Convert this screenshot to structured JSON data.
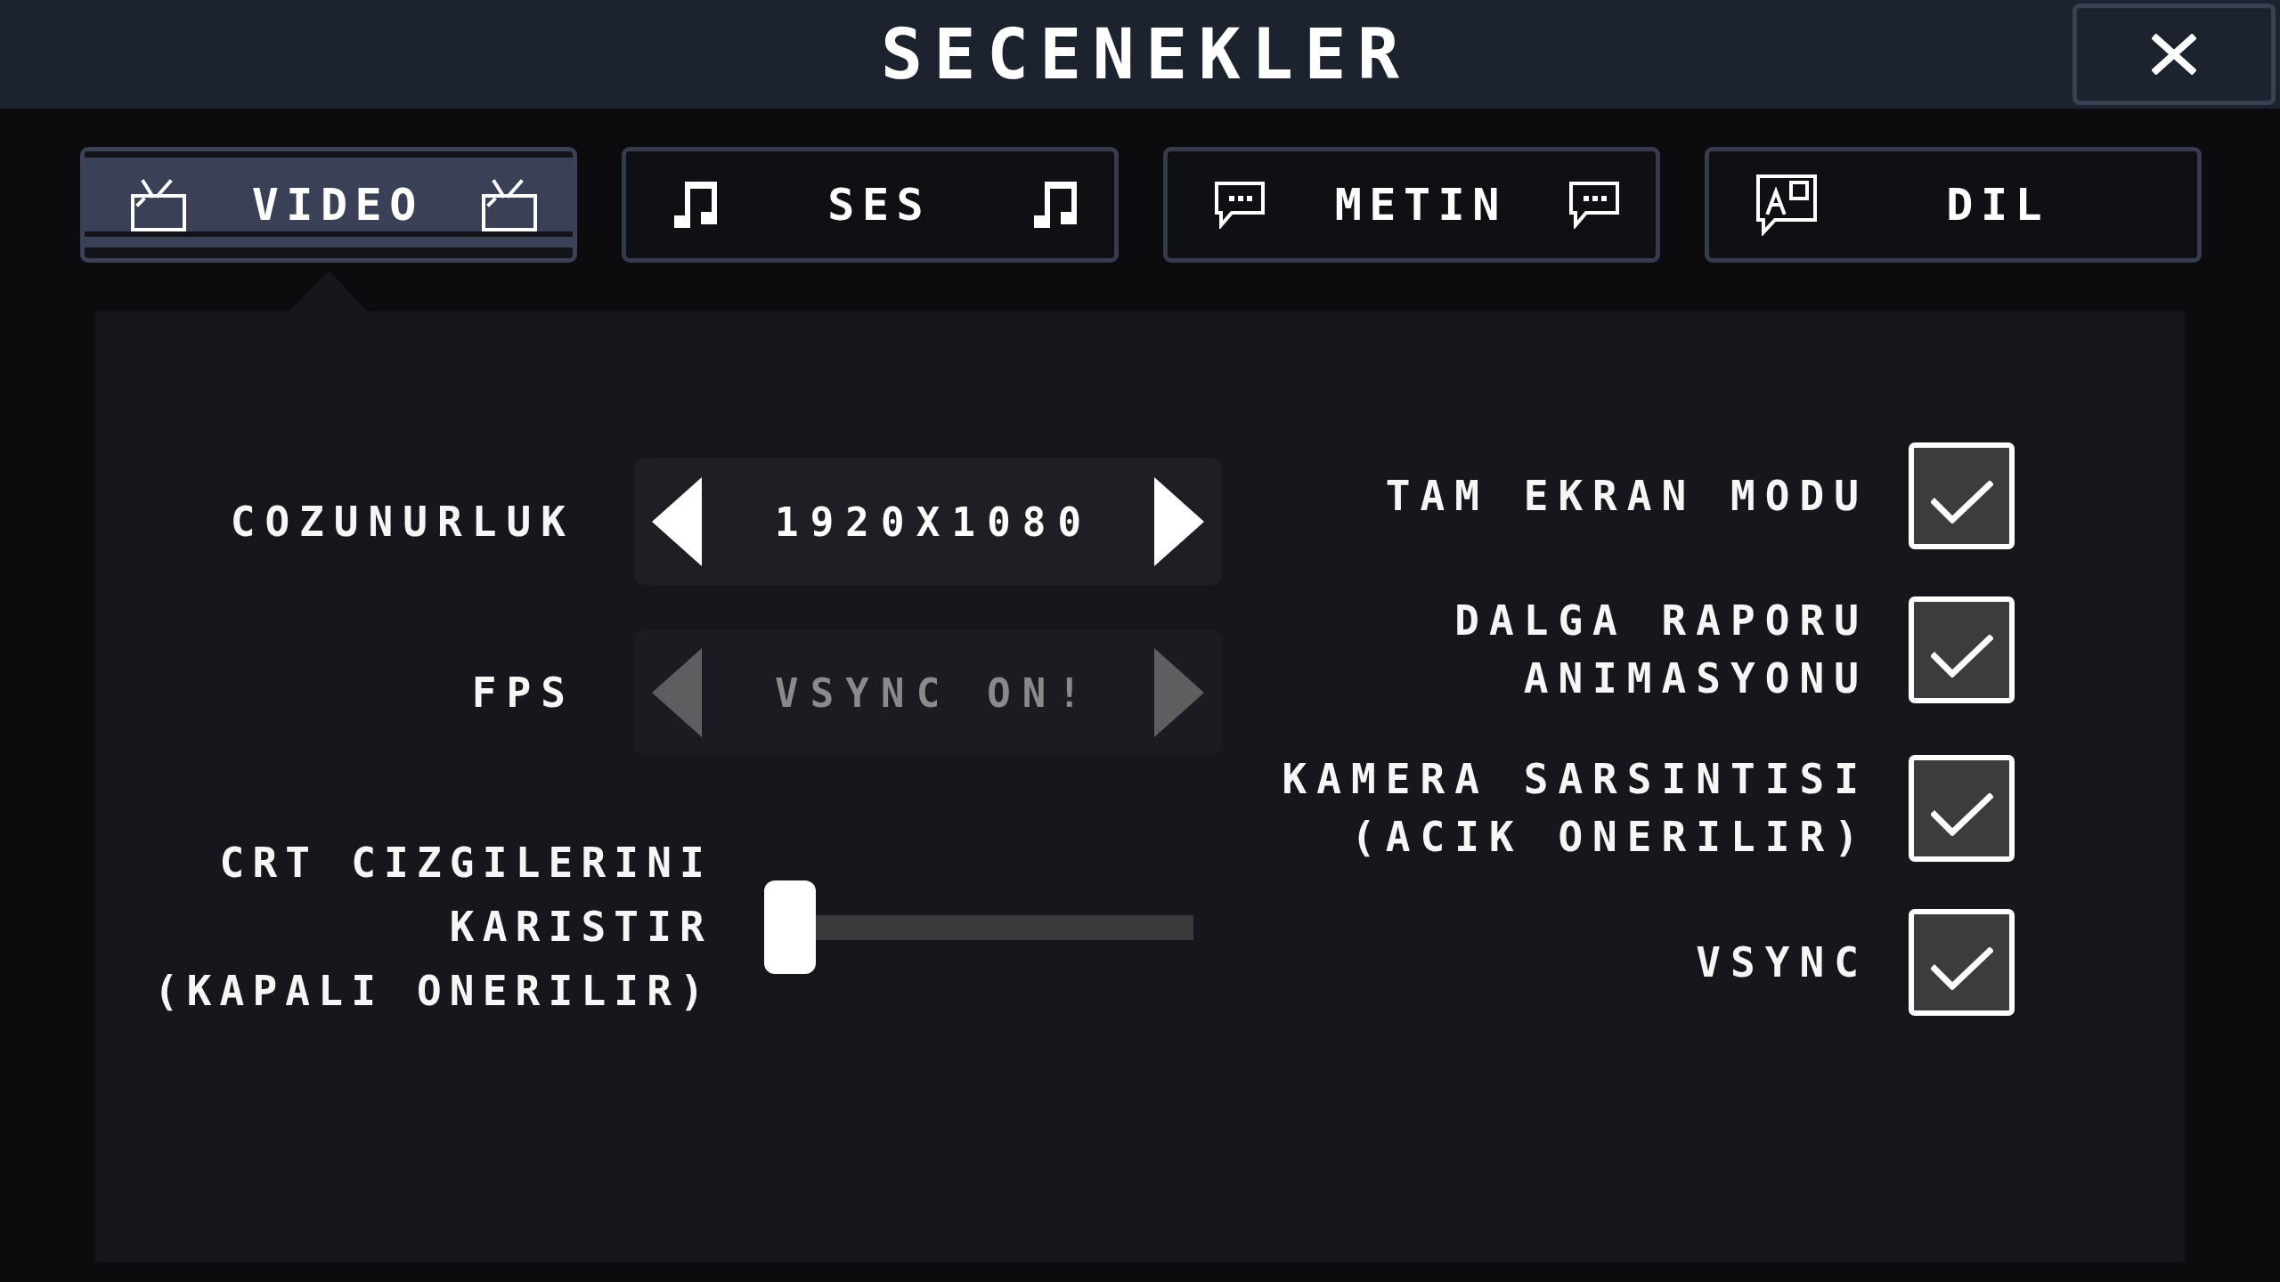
{
  "title": "SECENEKLER",
  "tabs": [
    {
      "label": "VIDEO",
      "kind": "video",
      "trailing_icon": true,
      "selected": true
    },
    {
      "label": "SES",
      "kind": "audio",
      "trailing_icon": true,
      "selected": false
    },
    {
      "label": "METIN",
      "kind": "text",
      "trailing_icon": true,
      "selected": false
    },
    {
      "label": "DIL",
      "kind": "language",
      "trailing_icon": false,
      "selected": false
    }
  ],
  "left_settings": [
    {
      "kind": "selector",
      "label_lines": [
        "COZUNURLUK"
      ],
      "value": "1920X1080",
      "disabled": false
    },
    {
      "kind": "selector",
      "label_lines": [
        "FPS"
      ],
      "value": "VSYNC ON!",
      "disabled": true
    },
    {
      "kind": "slider",
      "label_lines": [
        "CRT CIZGILERINI",
        "KARISTIR",
        "(KAPALI ONERILIR)"
      ],
      "level": 0.06
    }
  ],
  "right_settings": [
    {
      "label_lines": [
        "TAM EKRAN MODU"
      ],
      "checked": true
    },
    {
      "label_lines": [
        "DALGA RAPORU",
        "ANIMASYONU"
      ],
      "checked": true
    },
    {
      "label_lines": [
        "KAMERA SARSINTISI",
        "(ACIK ONERILIR)"
      ],
      "checked": true
    },
    {
      "label_lines": [
        "VSYNC"
      ],
      "checked": true
    }
  ]
}
